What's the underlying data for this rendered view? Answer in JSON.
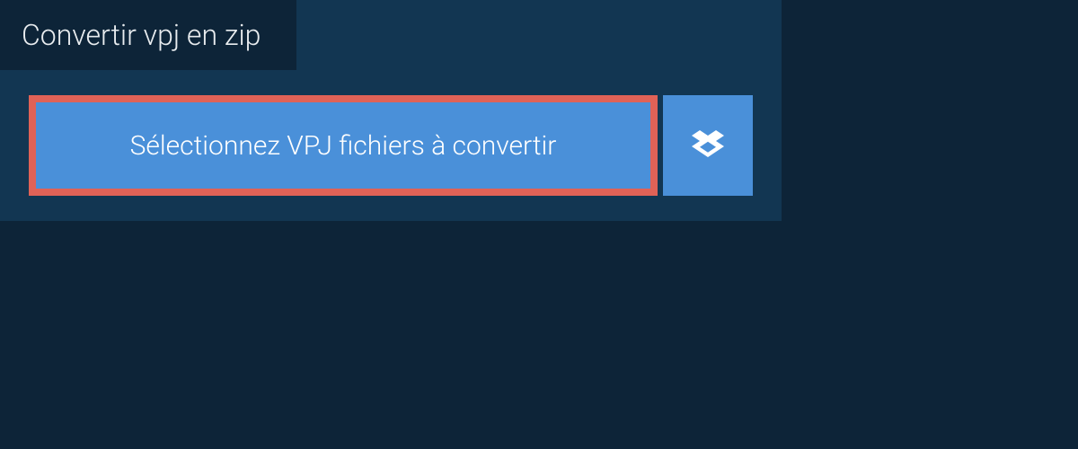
{
  "tab": {
    "label": "Convertir vpj en zip"
  },
  "upload": {
    "select_label": "Sélectionnez VPJ fichiers à convertir"
  },
  "colors": {
    "background": "#0d2438",
    "panel": "#123652",
    "button": "#4a90d9",
    "highlight_border": "#e06257",
    "text_light": "#e8ecef",
    "text_white": "#ffffff"
  }
}
